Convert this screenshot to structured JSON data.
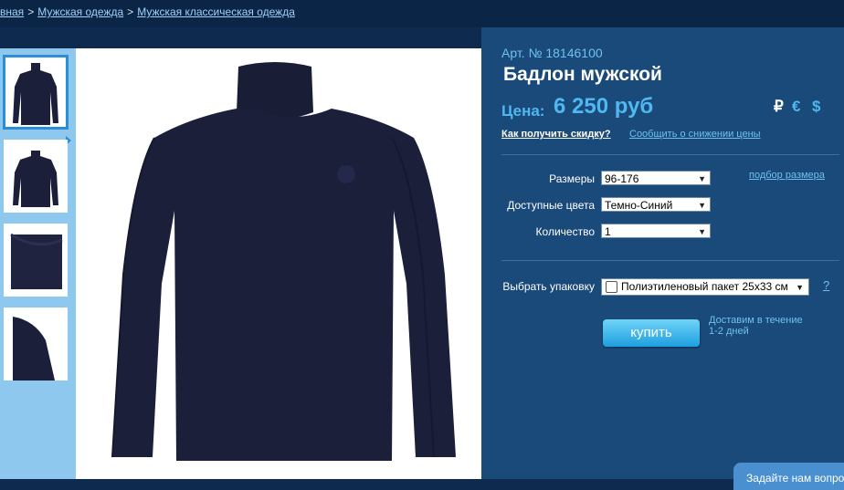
{
  "breadcrumb": {
    "items": [
      "вная",
      "Мужская одежда",
      "Мужская классическая одежда"
    ],
    "separator": ">"
  },
  "product": {
    "article": "Арт. № 18146100",
    "title": "Бадлон мужской",
    "price_label": "Цена:",
    "price_value": "6 250 руб",
    "currencies": [
      "₽",
      "€",
      "$"
    ],
    "discount_link": "Как получить скидку?",
    "notify_link": "Сообщить о снижении цены"
  },
  "options": {
    "size_label": "Размеры",
    "size_value": "96-176",
    "size_guide_link": "подбор размера",
    "color_label": "Доступные цвета",
    "color_value": "Темно-Синий",
    "quantity_label": "Количество",
    "quantity_value": "1"
  },
  "packaging": {
    "label": "Выбрать упаковку",
    "value": "Полиэтиленовый пакет 25х33 см",
    "help": "?"
  },
  "buy": {
    "button_label": "купить",
    "delivery_text": "Доставим в течение 1-2 дней"
  },
  "corner": {
    "label": "Задайте нам вопрос"
  },
  "colors": {
    "background": "#0e2a4e",
    "panel": "#1a4a7a",
    "accent": "#4fb8f0",
    "thumb_column": "#8ec8ee",
    "garment": "#1c1f3a"
  },
  "icons": {
    "dropdown": "chevron-down-icon",
    "thumb_pointer": "triangle-right-icon"
  }
}
